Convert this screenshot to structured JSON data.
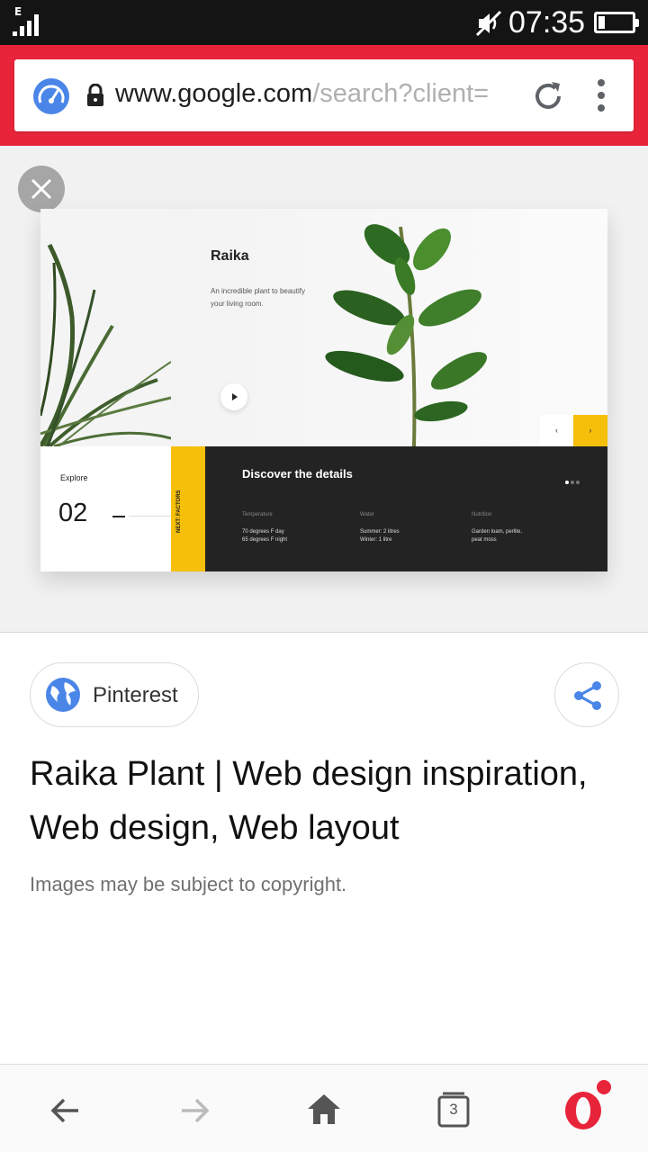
{
  "status_bar": {
    "network_type": "E",
    "time": "07:35",
    "battery_level": 0.2
  },
  "browser": {
    "url_host": "www.google.com",
    "url_path": "/search?client=",
    "accent_color": "#e8243a"
  },
  "preview_image": {
    "title": "Raika",
    "subtitle": "An incredible plant to beautify your living room.",
    "explore_label": "Explore",
    "explore_number": "02",
    "strip_text": "NEXT: FACTORS",
    "details_title": "Discover the details",
    "factors": [
      {
        "label": "Temperature",
        "value": "70 degrees F day\n65 degrees F night"
      },
      {
        "label": "Water",
        "value": "Summer: 2 litres\nWinter: 1 litre"
      },
      {
        "label": "Nutrition",
        "value": "Garden loam, perlite,\npeat moss"
      }
    ],
    "nav_prev": "‹",
    "nav_next": "›"
  },
  "result": {
    "source": "Pinterest",
    "title": "Raika Plant | Web design inspiration, Web design, Web layout",
    "copyright_notice": "Images may be subject to copyright."
  },
  "bottom_nav": {
    "tab_count": "3",
    "icons": [
      "back-icon",
      "forward-icon",
      "home-icon",
      "tabs-icon",
      "opera-menu-icon"
    ]
  }
}
